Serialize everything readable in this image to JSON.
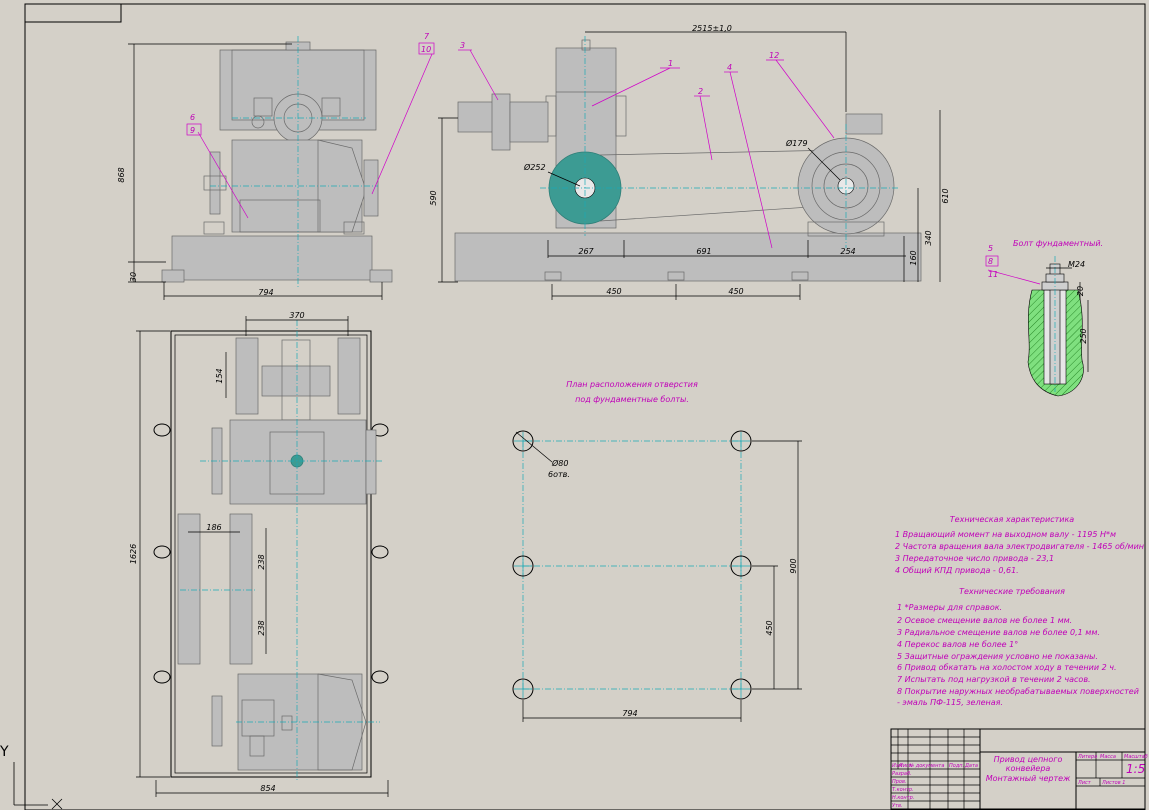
{
  "views": {
    "front": {
      "dims": {
        "height": "868",
        "bottom_gap": "30",
        "width": "794"
      },
      "labels": {
        "l6": "6",
        "l9": "9",
        "l7": "7",
        "l10": "10"
      }
    },
    "side": {
      "dims": {
        "overall_length": "2515±1,0",
        "height_left": "590",
        "height_right": "610",
        "seg1": "267",
        "seg2": "691",
        "seg3": "254",
        "base_h": "160",
        "motor_axis_h": "340",
        "foot1": "450",
        "foot2": "450",
        "pulley_small": "Ø179",
        "pulley_large": "Ø252"
      },
      "labels": {
        "l1": "1",
        "l2": "2",
        "l3": "3",
        "l4": "4",
        "l12": "12"
      }
    },
    "plan": {
      "dims": {
        "top_width": "370",
        "v154": "154",
        "h186": "186",
        "v238a": "238",
        "v238b": "238",
        "length": "1626",
        "width": "854"
      }
    },
    "holes": {
      "title_line1": "План расположения отверстия",
      "title_line2": "под фундаментные болты.",
      "hole_dia": "Ø80",
      "hole_note": "6отв.",
      "dim_h": "794",
      "dim_v_total": "900",
      "dim_v_half": "450"
    },
    "bolt": {
      "title": "Болт фундаментный.",
      "labels": {
        "l5": "5",
        "l8": "8",
        "l11": "11"
      },
      "thread": "М24",
      "d20": "20",
      "d250": "250"
    }
  },
  "tech_char": {
    "title": "Техническая характеристика",
    "items": [
      "1 Вращающий момент на выходном валу - 1195 Н*м",
      "2 Частота вращения вала электродвигателя - 1465 об/мин",
      "3 Передаточное число привода              - 23,1",
      "4 Общий КПД привода                            - 0,61."
    ]
  },
  "tech_req": {
    "title": "Технические требования",
    "items": [
      "1 *Размеры для справок.",
      "2 Осевое смещение валов не более 1 мм.",
      "3 Радиальное смещение валов не более 0,1 мм.",
      "4 Перекос валов не более 1°",
      "5 Защитные ограждения условно не показаны.",
      "6 Привод обкатать на холостом ходу в течении 2 ч.",
      "7 Испытать под нагрузкой в течении 2 часов.",
      "8 Покрытие наружных необрабатываемых поверхностей",
      "   - эмаль ПФ-115, зеленая."
    ]
  },
  "title_block": {
    "name_line1": "Привод цепного",
    "name_line2": "конвейера",
    "name_line3": "Монтажный чертеж",
    "scale": "1:5",
    "hdr_lit": "Литера",
    "hdr_mass": "Масса",
    "hdr_scale": "Масштаб",
    "sheet": "Лист",
    "sheets": "Листов 1",
    "col_izm": "Изм",
    "col_list": "Лист",
    "col_doc": "№ документа",
    "col_sign": "Подп.",
    "col_date": "Дата",
    "role_dev": "Разраб.",
    "role_chk": "Пров.",
    "role_tk": "Т.контр.",
    "role_nk": "Н.контр.",
    "role_appr": "Утв."
  },
  "ucs": {
    "y": "Y",
    "x": "X"
  }
}
